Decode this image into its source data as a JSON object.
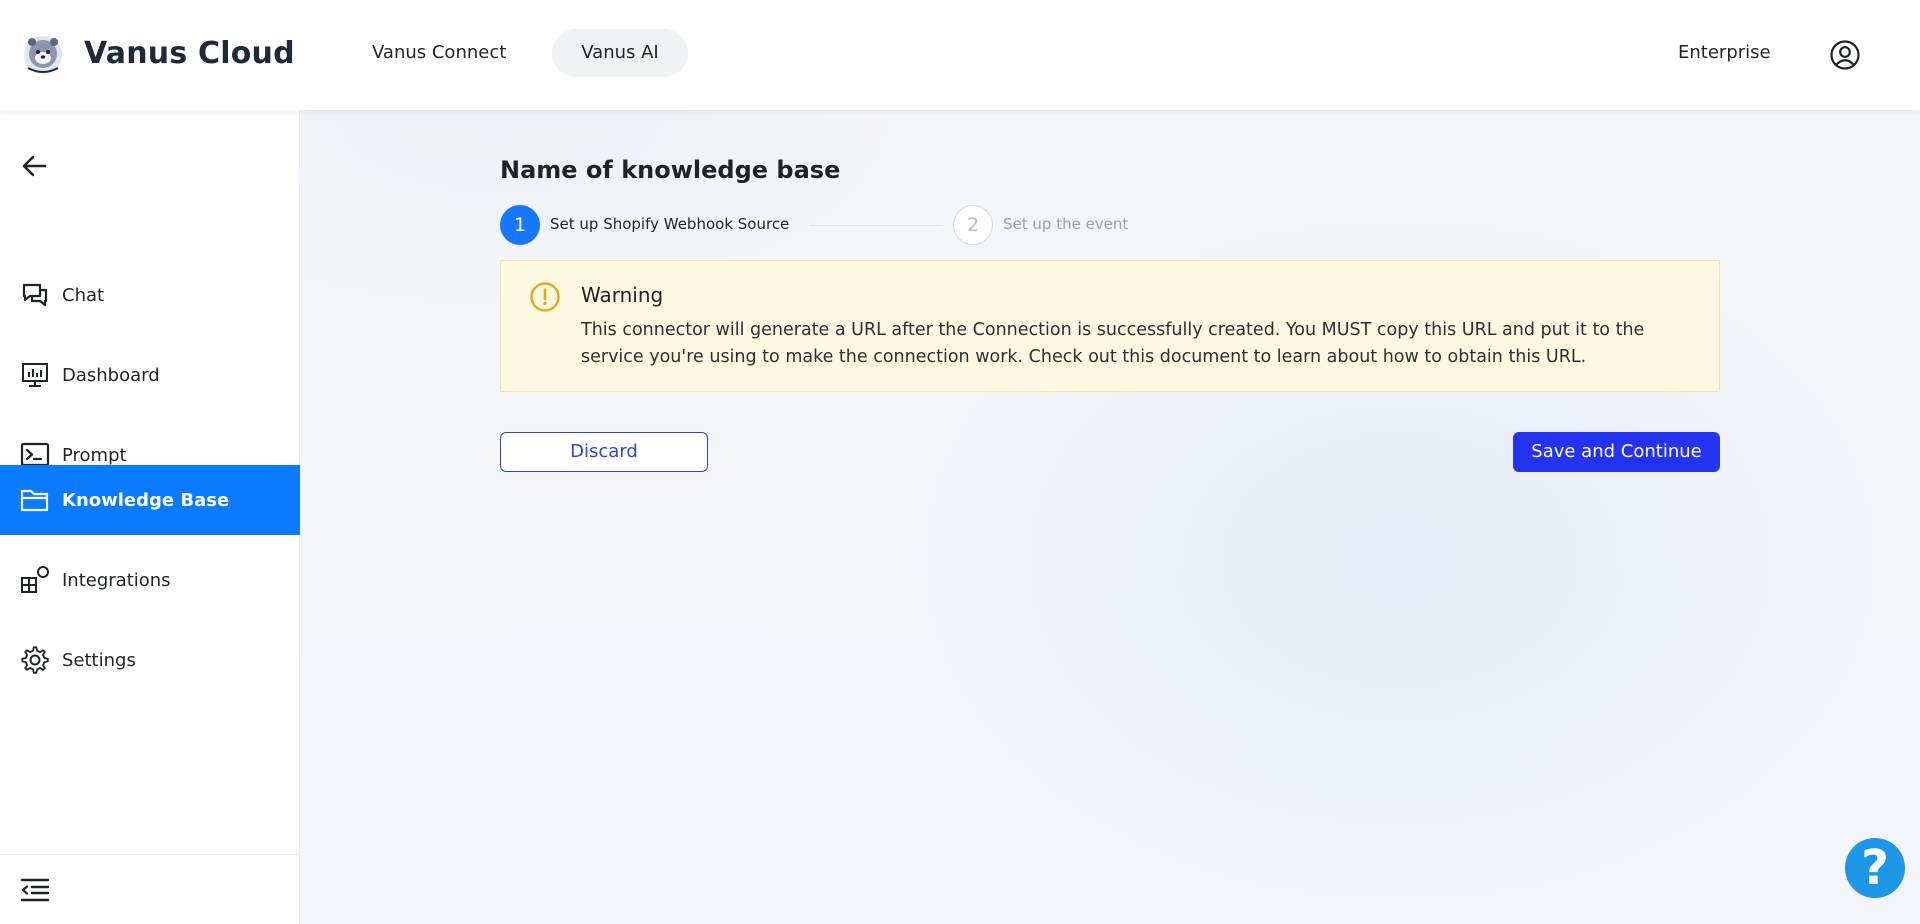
{
  "header": {
    "brand": "Vanus Cloud",
    "tabs": [
      {
        "label": "Vanus Connect"
      },
      {
        "label": "Vanus AI"
      }
    ],
    "plan": "Enterprise"
  },
  "sidebar": {
    "items": [
      {
        "label": "Chat",
        "icon": "chat-icon"
      },
      {
        "label": "Dashboard",
        "icon": "dashboard-icon"
      },
      {
        "label": "Prompt",
        "icon": "terminal-icon"
      },
      {
        "label": "Knowledge Base",
        "icon": "folder-icon",
        "active": true
      },
      {
        "label": "Integrations",
        "icon": "integrations-icon"
      },
      {
        "label": "Settings",
        "icon": "gear-icon"
      }
    ]
  },
  "main": {
    "title": "Name of knowledge base",
    "steps": [
      {
        "number": "1",
        "label": "Set up Shopify Webhook Source",
        "active": true
      },
      {
        "number": "2",
        "label": "Set up the event",
        "active": false
      }
    ],
    "warning": {
      "title": "Warning",
      "text": "This connector will generate a URL after the Connection is successfully created. You MUST copy this URL and put it to the service you're using to make the connection work. Check out this document to learn about how to obtain this URL."
    },
    "discard_label": "Discard",
    "save_label": "Save and Continue"
  },
  "help": {
    "label": "?"
  },
  "colors": {
    "accent": "#0a7bff",
    "primary_button": "#2433f0",
    "warning_bg": "#fdf9e0",
    "warning_icon": "#e6a817"
  }
}
